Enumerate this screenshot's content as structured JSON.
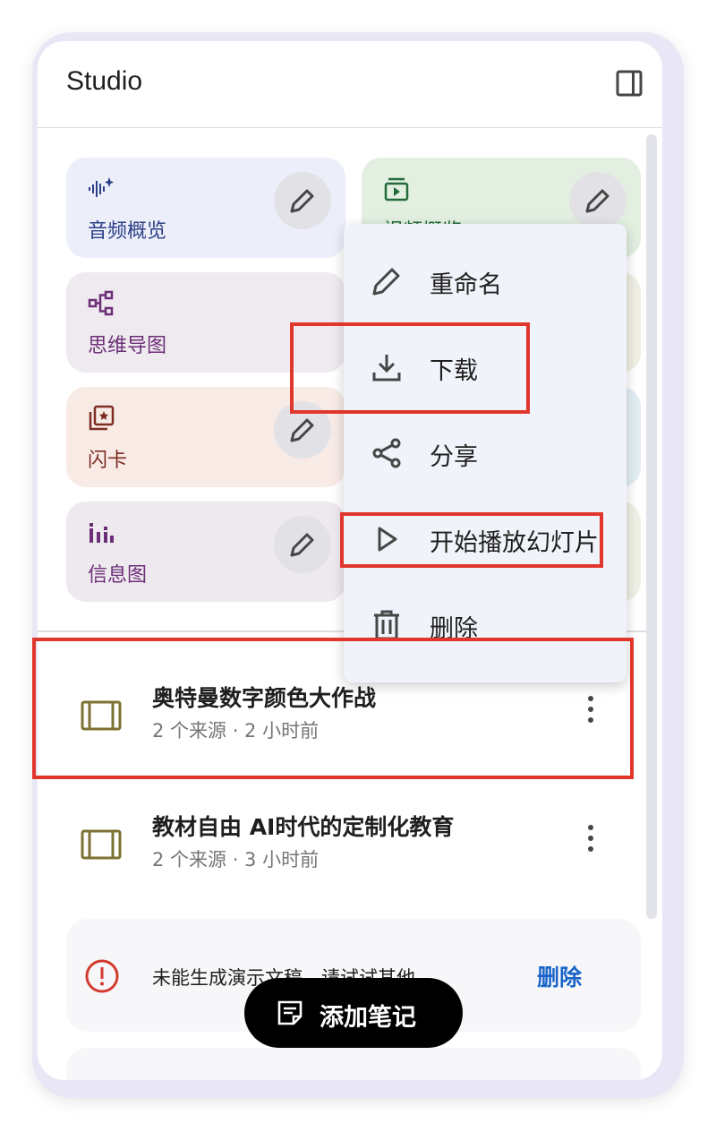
{
  "panel": {
    "title": "Studio",
    "toggle_icon": "side-panel-icon"
  },
  "tiles": [
    {
      "label": "音频概览",
      "icon": "audio-waveform-icon",
      "bg": "#eceefa",
      "fg": "#2b3f86"
    },
    {
      "label": "视频概览",
      "icon": "video-slides-icon",
      "bg": "#e2efe1",
      "fg": "#236b3a"
    },
    {
      "label": "思维导图",
      "icon": "mind-map-icon",
      "bg": "#eeeaf0",
      "fg": "#6c2f77"
    },
    {
      "label": "闪卡",
      "icon": "flashcards-icon",
      "bg": "#f8ebe6",
      "fg": "#7d2d23"
    },
    {
      "label": "信息图",
      "icon": "infographic-icon",
      "bg": "#eee8ef",
      "fg": "#6c2f77"
    }
  ],
  "context_menu": {
    "items": [
      {
        "label": "重命名",
        "icon": "pencil-icon"
      },
      {
        "label": "下载",
        "icon": "download-icon"
      },
      {
        "label": "分享",
        "icon": "share-icon"
      },
      {
        "label": "开始播放幻灯片",
        "icon": "play-icon"
      },
      {
        "label": "删除",
        "icon": "trash-icon"
      }
    ]
  },
  "notes": [
    {
      "title": "奥特曼数字颜色大作战",
      "meta": "2 个来源 · 2 小时前",
      "icon": "slides-deck-icon"
    },
    {
      "title": "教材自由 AI时代的定制化教育",
      "meta": "2 个来源 · 3 小时前",
      "icon": "slides-deck-icon"
    }
  ],
  "error_card": {
    "text": "未能生成演示文稿。请试试其他...",
    "delete_label": "删除",
    "icon": "error-circle-icon"
  },
  "fab": {
    "label": "添加笔记",
    "icon": "note-icon"
  },
  "colors": {
    "accent_blue": "#1a64c8",
    "highlight_red": "#e0362c",
    "deck_icon": "#7c7232"
  }
}
